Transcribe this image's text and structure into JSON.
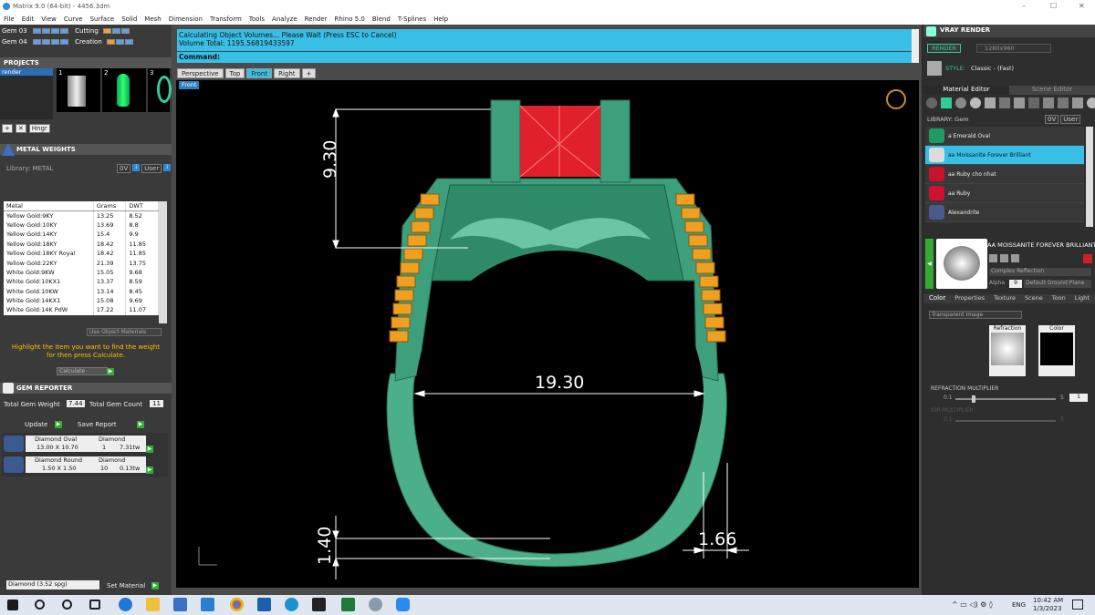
{
  "window": {
    "title": "Matrix 9.0 (64-bit) - 4456.3dm",
    "min": "–",
    "max": "☐",
    "close": "✕"
  },
  "menu": [
    "File",
    "Edit",
    "View",
    "Curve",
    "Surface",
    "Solid",
    "Mesh",
    "Dimension",
    "Transform",
    "Tools",
    "Analyze",
    "Render",
    "Rhino 5.0",
    "Blend",
    "T-Splines",
    "Help"
  ],
  "layers": [
    {
      "name": "Gem 03",
      "state": "Cutting"
    },
    {
      "name": "Gem 04",
      "state": "Creation"
    }
  ],
  "projects": {
    "title": "PROJECTS",
    "item": "render",
    "thumbs": [
      "1",
      "2",
      "3"
    ],
    "hinge_label": "Hngr"
  },
  "metal_weights": {
    "title": "METAL WEIGHTS",
    "library": "Library: METAL",
    "lib_tabs": [
      "0V",
      "User"
    ],
    "columns": [
      "Metal",
      "Grams",
      "DWT"
    ],
    "rows": [
      [
        "Yellow Gold:9KY",
        "13.25",
        "8.52"
      ],
      [
        "Yellow Gold:10KY",
        "13.69",
        "8.8"
      ],
      [
        "Yellow Gold:14KY",
        "15.4",
        "9.9"
      ],
      [
        "Yellow Gold:18KY",
        "18.42",
        "11.85"
      ],
      [
        "Yellow Gold:18KY Royal",
        "18.42",
        "11.85"
      ],
      [
        "Yellow Gold:22KY",
        "21.39",
        "13.75"
      ],
      [
        "White Gold:9KW",
        "15.05",
        "9.68"
      ],
      [
        "White Gold:10KX1",
        "13.37",
        "8.59"
      ],
      [
        "White Gold:10KW",
        "13.14",
        "8.45"
      ],
      [
        "White Gold:14KX1",
        "15.08",
        "9.69"
      ],
      [
        "White Gold:14K PdW",
        "17.22",
        "11.07"
      ]
    ],
    "use_obj": "Use Object Materials",
    "hint": "Highlight the item you want to find the weight for then press Calculate.",
    "calc": "Calculate"
  },
  "gem_reporter": {
    "title": "GEM REPORTER",
    "total_weight_label": "Total Gem Weight",
    "total_weight": "7.44",
    "total_count_label": "Total Gem Count",
    "total_count": "11",
    "update": "Update",
    "save": "Save Report",
    "gems": [
      {
        "name": "Diamond Oval",
        "material": "Diamond",
        "size": "13.00 X 10.70",
        "count": "1",
        "weight": "7.31tw"
      },
      {
        "name": "Diamond Round",
        "material": "Diamond",
        "size": "1.50 X 1.50",
        "count": "10",
        "weight": "0.13tw"
      }
    ],
    "material_select": "Diamond   (3.52 spg)",
    "set_material": "Set Material"
  },
  "command": {
    "line1": "Calculating Object Volumes... Please Wait (Press ESC to Cancel)",
    "line2": "Volume Total: 1195.56819433597",
    "prompt": "Command:"
  },
  "viewport_tabs": [
    "Perspective",
    "Top",
    "Front",
    "Right",
    "+"
  ],
  "viewport_label": "Front",
  "dimensions": {
    "top": "9.30",
    "inner": "19.30",
    "bottom_left": "1.40",
    "bottom_right": "1.66"
  },
  "vray": {
    "title": "VRAY RENDER",
    "render_btn": "RENDER",
    "resolution": "1280x960",
    "style_label": "STYLE:",
    "style": "Classic - (Fast)",
    "tabs": [
      "Material Editor",
      "Scene Editor"
    ],
    "library": "LIBRARY: Gem",
    "lib_tabs": [
      "0V",
      "User"
    ],
    "materials": [
      {
        "name": "a Emerald Oval",
        "color": "#1f9a63"
      },
      {
        "name": "aa Moissanite Forever Brilliant",
        "color": "#dcdcdc"
      },
      {
        "name": "aa Ruby cho nhat",
        "color": "#c8142a"
      },
      {
        "name": "aa Ruby",
        "color": "#d01030"
      },
      {
        "name": "Alexandrite",
        "color": "#4a5a8a"
      }
    ],
    "selected_name": "AA MOISSANITE FOREVER BRILLIANT",
    "shader": "Complex Reflection",
    "alpha": "Alpha",
    "alpha_val": "9",
    "ground": "Default Ground Plane",
    "prop_tabs": [
      "Color",
      "Properties",
      "Texture",
      "Scene",
      "Toon",
      "Light"
    ],
    "transparent": "Transparent Image",
    "refraction": "Refraction",
    "color": "Color",
    "refr_mult": "REFRACTION MULTIPLIER",
    "mult_min": "0.1",
    "mult_max": "5",
    "mult_val": "1",
    "ior": "IOR MULTIPLIER",
    "ior_min": "0.1",
    "ior_max": "5"
  },
  "taskbar": {
    "lang": "ENG",
    "time": "10:42 AM",
    "date": "1/3/2023"
  }
}
